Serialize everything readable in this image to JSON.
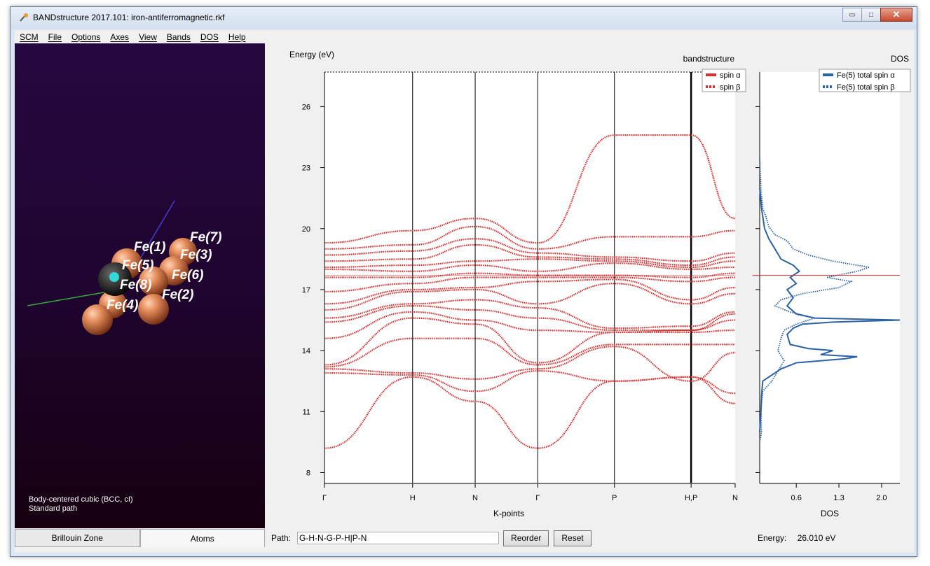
{
  "window": {
    "title": "BANDstructure 2017.101: iron-antiferromagnetic.rkf",
    "min_glyph": "▭",
    "max_glyph": "□",
    "close_glyph": "✕"
  },
  "menu": [
    "SCM",
    "File",
    "Options",
    "Axes",
    "View",
    "Bands",
    "DOS",
    "Help"
  ],
  "viewer": {
    "atoms": [
      {
        "label": "Fe(7)"
      },
      {
        "label": "Fe(1)"
      },
      {
        "label": "Fe(3)"
      },
      {
        "label": "Fe(5)"
      },
      {
        "label": "Fe(6)"
      },
      {
        "label": "Fe(8)"
      },
      {
        "label": "Fe(2)"
      },
      {
        "label": "Fe(4)"
      }
    ],
    "lattice_line1": "Body-centered cubic (BCC, cI)",
    "lattice_line2": "Standard path"
  },
  "tabs": {
    "brillouin": "Brillouin Zone",
    "atoms": "Atoms"
  },
  "path": {
    "label": "Path:",
    "value": "G-H-N-G-P-H|P-N",
    "reorder": "Reorder",
    "reset": "Reset"
  },
  "status": {
    "label": "Energy:",
    "value": "26.010 eV"
  },
  "colors": {
    "band": "#dc2b2b",
    "dos": "#2a62a5",
    "fermi": "#dc2b2b"
  },
  "chart_data": [
    {
      "type": "line",
      "title": "bandstructure",
      "ylabel": "Energy (eV)",
      "xlabel": "K-points",
      "ylim": [
        7.5,
        27.7
      ],
      "yticks": [
        8,
        11,
        14,
        17,
        20,
        23,
        26
      ],
      "fermi": 17.7,
      "kpoints": [
        {
          "label": "Γ",
          "pos": 0
        },
        {
          "label": "H",
          "pos": 1.0
        },
        {
          "label": "N",
          "pos": 1.71
        },
        {
          "label": "Γ",
          "pos": 2.42
        },
        {
          "label": "P",
          "pos": 3.29
        },
        {
          "label": "H,P",
          "pos": 4.16
        },
        {
          "label": "N",
          "pos": 4.66
        }
      ],
      "series": [
        {
          "name": "spin α",
          "style": "solid"
        },
        {
          "name": "spin β",
          "style": "dotted"
        }
      ],
      "bands": [
        [
          9.2,
          12.7,
          11.5,
          9.2,
          12.5,
          12.7,
          11.4
        ],
        [
          12.9,
          12.8,
          12.0,
          13.0,
          12.5,
          12.7,
          11.9
        ],
        [
          13.1,
          12.9,
          12.6,
          13.1,
          14.2,
          12.5,
          13.9
        ],
        [
          13.2,
          14.6,
          14.6,
          13.3,
          14.3,
          14.3,
          14.3
        ],
        [
          13.3,
          15.6,
          15.3,
          13.4,
          14.9,
          14.9,
          15.0
        ],
        [
          14.6,
          15.9,
          15.5,
          15.0,
          14.9,
          15.0,
          15.5
        ],
        [
          15.4,
          16.2,
          16.0,
          15.6,
          15.0,
          15.0,
          15.8
        ],
        [
          15.6,
          16.3,
          16.5,
          16.1,
          15.1,
          15.2,
          15.9
        ],
        [
          16.0,
          16.9,
          17.0,
          16.3,
          17.3,
          16.3,
          16.8
        ],
        [
          16.3,
          17.0,
          17.1,
          17.4,
          17.5,
          16.5,
          17.1
        ],
        [
          16.9,
          17.3,
          17.6,
          17.6,
          17.6,
          17.4,
          17.6
        ],
        [
          17.6,
          17.6,
          17.8,
          17.7,
          17.7,
          17.6,
          17.8
        ],
        [
          18.0,
          17.9,
          18.2,
          17.9,
          18.3,
          18.0,
          18.1
        ],
        [
          18.1,
          18.2,
          18.4,
          18.5,
          18.4,
          18.1,
          18.4
        ],
        [
          18.4,
          18.5,
          19.2,
          18.6,
          18.5,
          18.2,
          18.6
        ],
        [
          18.7,
          18.9,
          19.5,
          18.8,
          18.6,
          18.4,
          18.8
        ],
        [
          19.0,
          19.2,
          20.1,
          19.0,
          19.6,
          19.6,
          19.9
        ],
        [
          19.3,
          19.9,
          20.5,
          19.3,
          24.6,
          24.6,
          20.5
        ]
      ]
    },
    {
      "type": "line",
      "title": "DOS",
      "xlabel": "DOS",
      "xticks": [
        0.6,
        1.3,
        2.0
      ],
      "xlim": [
        0,
        2.3
      ],
      "ylim": [
        7.5,
        27.7
      ],
      "series": [
        {
          "name": "Fe(5)  total spin α",
          "style": "solid",
          "points": [
            [
              0.0,
              10.0
            ],
            [
              0.02,
              11.0
            ],
            [
              0.03,
              11.8
            ],
            [
              0.05,
              12.5
            ],
            [
              0.35,
              13.1
            ],
            [
              0.6,
              13.4
            ],
            [
              1.4,
              13.6
            ],
            [
              1.6,
              13.7
            ],
            [
              1.0,
              13.8
            ],
            [
              1.2,
              14.0
            ],
            [
              0.8,
              14.1
            ],
            [
              0.5,
              14.3
            ],
            [
              0.45,
              14.8
            ],
            [
              0.55,
              15.1
            ],
            [
              0.7,
              15.3
            ],
            [
              1.2,
              15.4
            ],
            [
              2.3,
              15.5
            ],
            [
              0.9,
              15.6
            ],
            [
              0.6,
              15.8
            ],
            [
              0.45,
              16.2
            ],
            [
              0.55,
              16.6
            ],
            [
              0.45,
              17.0
            ],
            [
              0.6,
              17.3
            ],
            [
              0.5,
              17.6
            ],
            [
              0.65,
              17.9
            ],
            [
              0.55,
              18.2
            ],
            [
              0.35,
              18.5
            ],
            [
              0.25,
              19.0
            ],
            [
              0.15,
              19.5
            ],
            [
              0.08,
              20.0
            ],
            [
              0.03,
              21.0
            ],
            [
              0.0,
              22.0
            ]
          ]
        },
        {
          "name": "Fe(5)  total spin β",
          "style": "dotted",
          "points": [
            [
              0.0,
              9.5
            ],
            [
              0.03,
              10.0
            ],
            [
              0.02,
              11.0
            ],
            [
              0.05,
              12.0
            ],
            [
              0.2,
              12.5
            ],
            [
              0.3,
              13.0
            ],
            [
              0.4,
              13.5
            ],
            [
              0.3,
              14.0
            ],
            [
              0.35,
              14.6
            ],
            [
              0.4,
              15.0
            ],
            [
              0.6,
              15.3
            ],
            [
              0.9,
              15.6
            ],
            [
              0.5,
              15.9
            ],
            [
              0.25,
              16.2
            ],
            [
              0.35,
              16.5
            ],
            [
              0.7,
              16.8
            ],
            [
              1.3,
              17.1
            ],
            [
              1.5,
              17.4
            ],
            [
              1.1,
              17.6
            ],
            [
              1.6,
              17.9
            ],
            [
              1.8,
              18.1
            ],
            [
              1.2,
              18.4
            ],
            [
              0.8,
              18.7
            ],
            [
              0.55,
              19.0
            ],
            [
              0.45,
              19.4
            ],
            [
              0.25,
              19.7
            ],
            [
              0.15,
              20.1
            ],
            [
              0.1,
              20.6
            ],
            [
              0.05,
              21.0
            ],
            [
              0.02,
              22.0
            ],
            [
              0.0,
              23.5
            ]
          ]
        }
      ]
    }
  ]
}
